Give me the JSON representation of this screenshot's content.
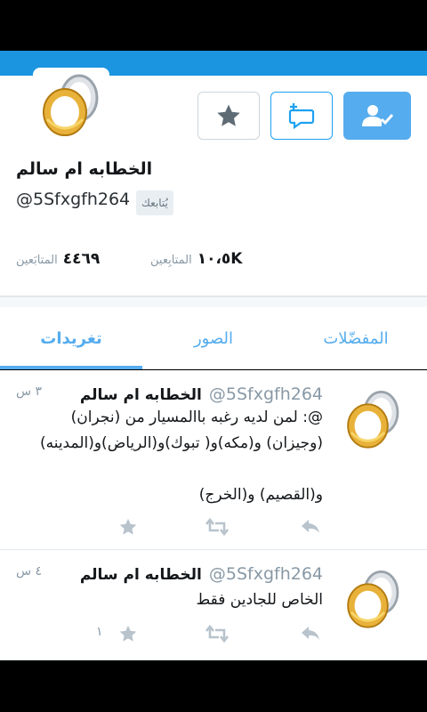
{
  "colors": {
    "accent": "#55acee",
    "banner": "#1b95e0",
    "text": "#14171a",
    "muted": "#8899a6"
  },
  "profile": {
    "name": "الخطابه ام  سالم",
    "handle": "@5Sfxgfh264",
    "follows_you_badge": "يُتابعك",
    "following_count": "٤٤٦٩",
    "following_label": "المتابَعين",
    "followers_count": "١٠،٥K",
    "followers_label": "المتابِعين",
    "avatar_icon": "rings-avatar",
    "buttons": [
      {
        "icon": "star-icon"
      },
      {
        "icon": "new-message-icon"
      },
      {
        "icon": "following-check-icon"
      }
    ]
  },
  "tabs": [
    {
      "label": "تغريدات",
      "active": true
    },
    {
      "label": "الصور",
      "active": false
    },
    {
      "label": "المفضّلات",
      "active": false
    }
  ],
  "tweets": [
    {
      "name": "الخطابه ام  سالم",
      "handle": "@5Sfxgfh264",
      "time": "٣ س",
      "text": "@: لمن لديه رغبه باالمسيار من (نجران)\n(وجيزان) و(مكه)و( تبوك)و(الرياض)و(المدينه)\n\nو(القصيم) و(الخرج)",
      "like_count": ""
    },
    {
      "name": "الخطابه ام  سالم",
      "handle": "@5Sfxgfh264",
      "time": "٤ س",
      "text": "الخاص للجادين فقط",
      "like_count": "١"
    }
  ]
}
